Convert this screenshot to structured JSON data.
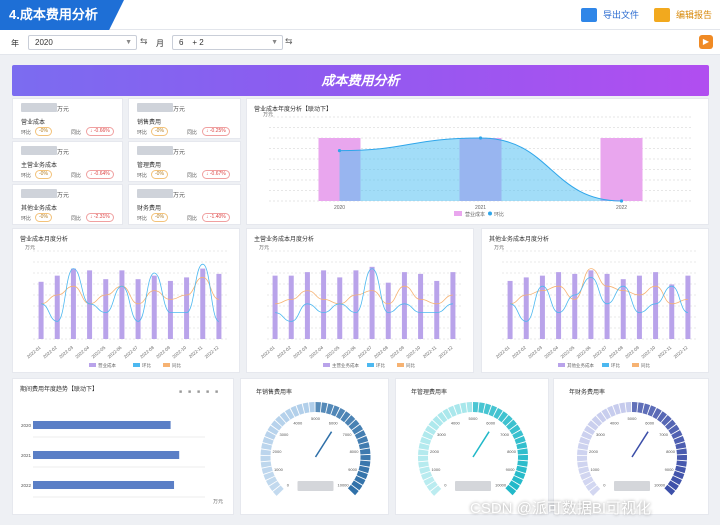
{
  "header": {
    "title": "4.成本费用分析",
    "export_label": "导出文件",
    "edit_label": "编辑报告"
  },
  "filters": {
    "year_label": "年",
    "year_value": "2020",
    "month_label": "月",
    "month_values": [
      "6",
      "+ 2"
    ]
  },
  "banner": {
    "title": "成本费用分析"
  },
  "kpis": [
    {
      "unit": "万元",
      "name": "营业成本",
      "mom": "-0%",
      "yoy": "↓ -0.66%"
    },
    {
      "unit": "万元",
      "name": "销售费用",
      "mom": "-0%",
      "yoy": "↓ -0.25%"
    },
    {
      "unit": "万元",
      "name": "主营业务成本",
      "mom": "-0%",
      "yoy": "↓ -0.64%"
    },
    {
      "unit": "万元",
      "name": "管理费用",
      "mom": "-0%",
      "yoy": "↓ -0.67%"
    },
    {
      "unit": "万元",
      "name": "其他业务成本",
      "mom": "-0%",
      "yoy": "↓ -2.31%"
    },
    {
      "unit": "万元",
      "name": "财务费用",
      "mom": "-0%",
      "yoy": "↓ -1.40%"
    }
  ],
  "kpi_labels": {
    "mom": "环比",
    "yoy": "同比"
  },
  "colors": {
    "accent": "#1e6fd6",
    "bar": "#b9a3ea",
    "purple_bar": "#e9a6ee",
    "line_blue": "#4cb8f0",
    "line_orange": "#f6b272",
    "gauge_dark": "#2e6fa8",
    "gauge_teal": "#1fb8c8",
    "gauge_navy": "#3b4ea8"
  },
  "chart_data": [
    {
      "type": "bar",
      "title": "营业成本年度分析【联动下】",
      "ylabel": "万元",
      "categories": [
        "2020",
        "2021",
        "2022"
      ],
      "series": [
        {
          "name": "营业成本",
          "values": [
            100,
            100,
            100
          ]
        },
        {
          "name": "环比",
          "values": [
            80,
            100,
            0
          ]
        }
      ],
      "legend": "bottom"
    },
    {
      "type": "bar",
      "title": "营业成本月度分析",
      "ylabel": "万元",
      "categories": [
        "2022-01",
        "2022-02",
        "2022-03",
        "2022-04",
        "2022-05",
        "2022-06",
        "2022-07",
        "2022-08",
        "2022-09",
        "2022-10",
        "2022-11",
        "2022-12"
      ],
      "series": [
        {
          "name": "营业成本",
          "values": [
            65,
            72,
            80,
            78,
            68,
            78,
            68,
            72,
            66,
            70,
            80,
            74
          ]
        },
        {
          "name": "环比",
          "values": [
            40,
            20,
            80,
            40,
            30,
            60,
            20,
            75,
            30,
            30,
            85,
            20
          ]
        },
        {
          "name": "同比",
          "values": [
            40,
            50,
            60,
            40,
            50,
            60,
            40,
            55,
            45,
            50,
            70,
            45
          ]
        }
      ],
      "legend": "bottom"
    },
    {
      "type": "bar",
      "title": "主营业务成本月度分析",
      "ylabel": "万元",
      "categories": [
        "2022-01",
        "2022-02",
        "2022-03",
        "2022-04",
        "2022-05",
        "2022-06",
        "2022-07",
        "2022-08",
        "2022-09",
        "2022-10",
        "2022-11",
        "2022-12"
      ],
      "series": [
        {
          "name": "主营业务成本",
          "values": [
            72,
            72,
            76,
            78,
            70,
            78,
            82,
            64,
            76,
            74,
            66,
            76
          ]
        },
        {
          "name": "环比",
          "values": [
            30,
            20,
            40,
            30,
            40,
            30,
            80,
            30,
            40,
            30,
            30,
            40
          ]
        },
        {
          "name": "同比",
          "values": [
            40,
            45,
            55,
            45,
            40,
            50,
            55,
            40,
            60,
            45,
            40,
            50
          ]
        }
      ],
      "legend": "bottom"
    },
    {
      "type": "bar",
      "title": "其他业务成本月度分析",
      "ylabel": "万元",
      "categories": [
        "2022-01",
        "2022-02",
        "2022-03",
        "2022-04",
        "2022-05",
        "2022-06",
        "2022-07",
        "2022-08",
        "2022-09",
        "2022-10",
        "2022-11",
        "2022-12"
      ],
      "series": [
        {
          "name": "其他业务成本",
          "values": [
            66,
            70,
            72,
            76,
            74,
            78,
            74,
            68,
            72,
            76,
            62,
            72
          ]
        },
        {
          "name": "环比",
          "values": [
            40,
            20,
            60,
            30,
            50,
            70,
            40,
            60,
            30,
            40,
            60,
            30
          ]
        },
        {
          "name": "同比",
          "values": [
            40,
            50,
            55,
            60,
            45,
            80,
            60,
            55,
            50,
            60,
            40,
            45
          ]
        }
      ],
      "legend": "bottom"
    },
    {
      "type": "bar",
      "title": "期间费用年度趋势【联动下】",
      "categories": [
        "2020",
        "2021",
        "2022"
      ],
      "series": [
        {
          "name": "期间费用",
          "values": [
            80,
            85,
            82
          ]
        }
      ],
      "xlabel": "",
      "ylabel": "万元"
    }
  ],
  "gauges": [
    {
      "title": "年销售费用率",
      "ticks": [
        "0",
        "1000",
        "2000",
        "3000",
        "4000",
        "5000",
        "6000",
        "7000",
        "8000",
        "9000",
        "10000"
      ]
    },
    {
      "title": "年管理费用率",
      "ticks": [
        "0",
        "1000",
        "2000",
        "3000",
        "4000",
        "5000",
        "6000",
        "7000",
        "8000",
        "9000",
        "10000"
      ]
    },
    {
      "title": "年财务费用率",
      "ticks": [
        "0",
        "1000",
        "2000",
        "3000",
        "4000",
        "5000",
        "6000",
        "7000",
        "8000",
        "9000",
        "10000"
      ]
    }
  ],
  "watermark": "CSDN @派可数据BI可视化"
}
